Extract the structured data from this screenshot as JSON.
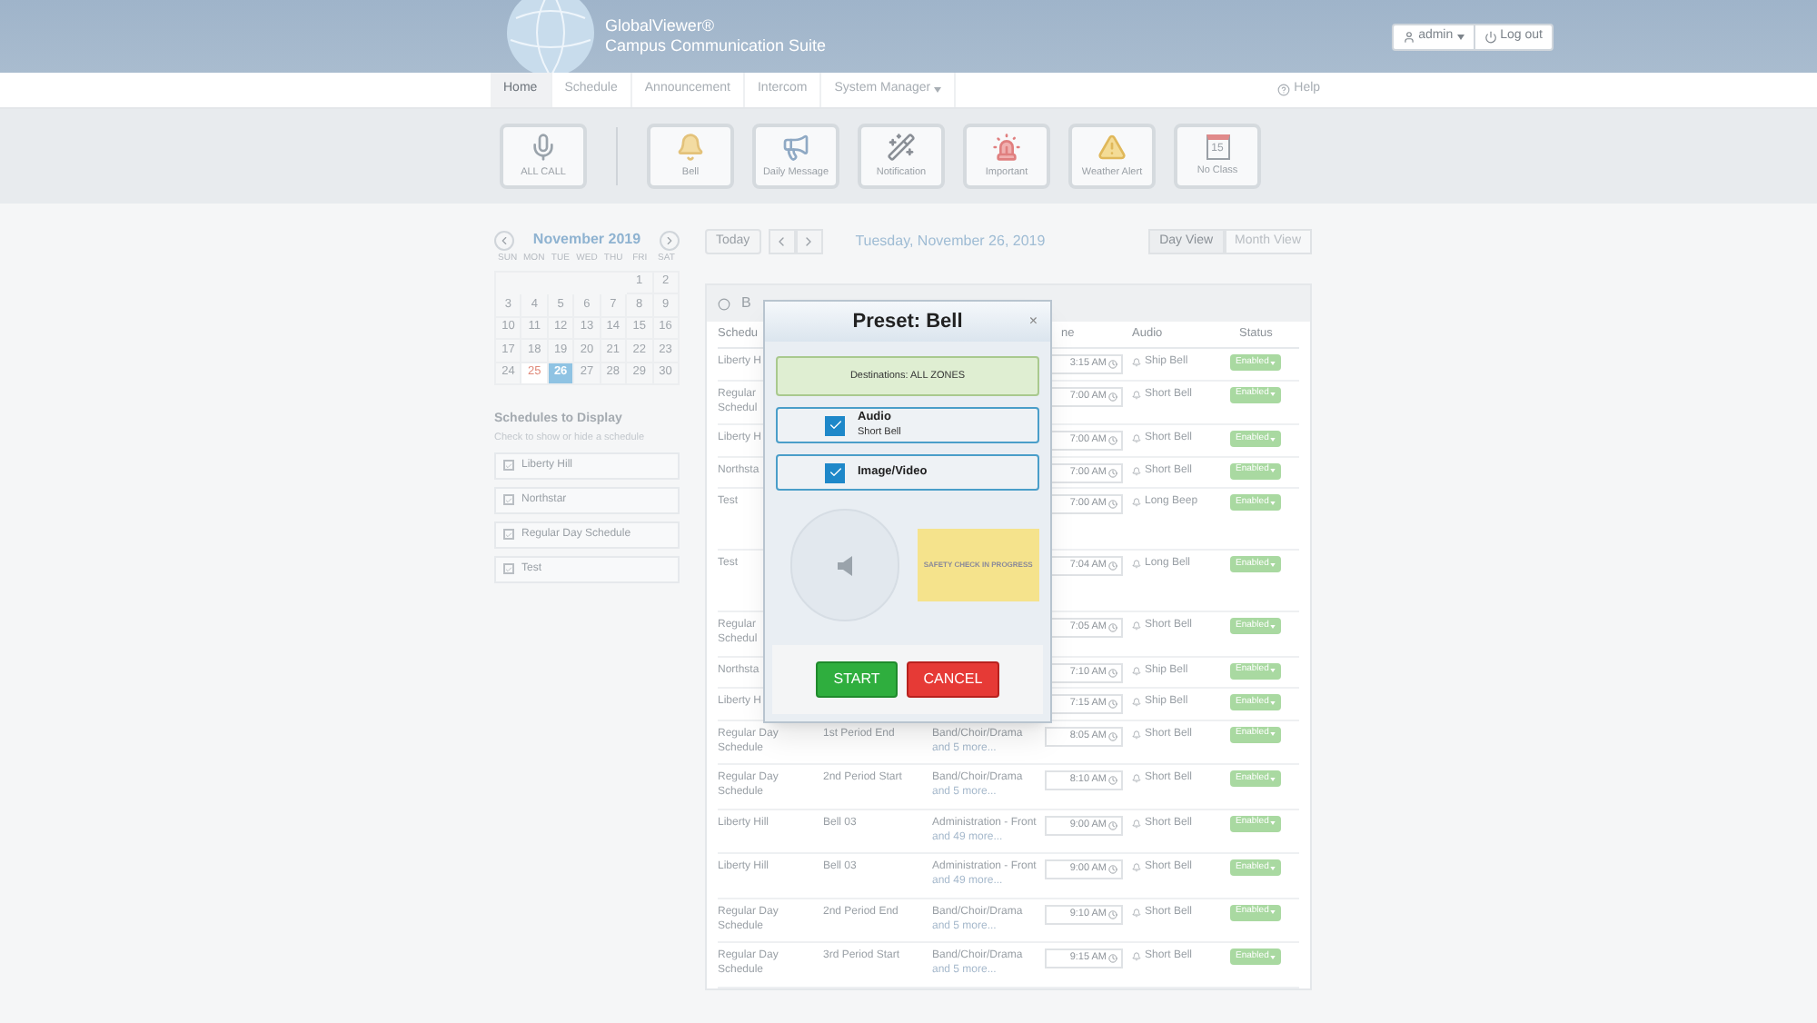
{
  "header": {
    "brand": "GlobalViewer®",
    "subtitle": "Campus Communication Suite",
    "user": "admin",
    "logout": "Log out"
  },
  "nav": {
    "tabs": [
      {
        "label": "Home",
        "selected": true
      },
      {
        "label": "Schedule",
        "selected": false
      },
      {
        "label": "Announcement",
        "selected": false
      },
      {
        "label": "Intercom",
        "selected": false
      },
      {
        "label": "System Manager",
        "selected": false,
        "dropdown": true
      }
    ],
    "help": "Help"
  },
  "presets": [
    {
      "label": "ALL CALL",
      "kind": "mic"
    },
    {
      "label": "Bell",
      "kind": "bell"
    },
    {
      "label": "Daily Message",
      "kind": "megaphone"
    },
    {
      "label": "Notification",
      "kind": "wand"
    },
    {
      "label": "Important",
      "kind": "siren"
    },
    {
      "label": "Weather Alert",
      "kind": "warning"
    },
    {
      "label": "No Class",
      "kind": "calendar",
      "icon_text": "15"
    }
  ],
  "calendar": {
    "month": "November 2019",
    "weekdays": [
      "SUN",
      "MON",
      "TUE",
      "WED",
      "THU",
      "FRI",
      "SAT"
    ],
    "days": [
      {
        "d": "1",
        "today": false,
        "selected": false
      },
      {
        "d": "2",
        "today": false,
        "selected": false
      },
      {
        "d": "3",
        "today": false,
        "selected": false
      },
      {
        "d": "4",
        "today": false,
        "selected": false
      },
      {
        "d": "5",
        "today": false,
        "selected": false
      },
      {
        "d": "6",
        "today": false,
        "selected": false
      },
      {
        "d": "7",
        "today": false,
        "selected": false
      },
      {
        "d": "8",
        "today": false,
        "selected": false
      },
      {
        "d": "9",
        "today": false,
        "selected": false
      },
      {
        "d": "10",
        "today": false,
        "selected": false
      },
      {
        "d": "11",
        "today": false,
        "selected": false
      },
      {
        "d": "12",
        "today": false,
        "selected": false
      },
      {
        "d": "13",
        "today": false,
        "selected": false
      },
      {
        "d": "14",
        "today": false,
        "selected": false
      },
      {
        "d": "15",
        "today": false,
        "selected": false
      },
      {
        "d": "16",
        "today": false,
        "selected": false
      },
      {
        "d": "17",
        "today": false,
        "selected": false
      },
      {
        "d": "18",
        "today": false,
        "selected": false
      },
      {
        "d": "19",
        "today": false,
        "selected": false
      },
      {
        "d": "20",
        "today": false,
        "selected": false
      },
      {
        "d": "21",
        "today": false,
        "selected": false
      },
      {
        "d": "22",
        "today": false,
        "selected": false
      },
      {
        "d": "23",
        "today": false,
        "selected": false
      },
      {
        "d": "24",
        "today": false,
        "selected": false
      },
      {
        "d": "25",
        "today": true,
        "selected": false
      },
      {
        "d": "26",
        "today": false,
        "selected": true
      },
      {
        "d": "27",
        "today": false,
        "selected": false
      },
      {
        "d": "28",
        "today": false,
        "selected": false
      },
      {
        "d": "29",
        "today": false,
        "selected": false
      },
      {
        "d": "30",
        "today": false,
        "selected": false
      }
    ]
  },
  "schedules": {
    "title": "Schedules to Display",
    "hint": "Check to show or hide a schedule",
    "items": [
      {
        "label": "Liberty Hill",
        "checked": true
      },
      {
        "label": "Northstar",
        "checked": true
      },
      {
        "label": "Regular Day Schedule",
        "checked": true
      },
      {
        "label": "Test",
        "checked": true
      }
    ]
  },
  "toolbar": {
    "today": "Today",
    "date": "Tuesday, November 26, 2019",
    "views": [
      {
        "label": "Day View",
        "selected": true
      },
      {
        "label": "Month View",
        "selected": false
      }
    ]
  },
  "panel": {
    "heading": "B"
  },
  "table": {
    "columns": [
      "Schedu",
      "ne",
      "Audio",
      "Status"
    ],
    "rows": [
      {
        "schedule": "Liberty H",
        "time": "3:15 AM",
        "audio": "Ship Bell",
        "status": "Enabled"
      },
      {
        "schedule": "Regular Schedul",
        "time": "7:00 AM",
        "audio": "Short Bell",
        "status": "Enabled",
        "kind": "double"
      },
      {
        "schedule": "Liberty H",
        "time": "7:00 AM",
        "audio": "Short Bell",
        "status": "Enabled"
      },
      {
        "schedule": "Northsta",
        "time": "7:00 AM",
        "audio": "Short Bell",
        "status": "Enabled"
      },
      {
        "schedule": "Test",
        "time": "7:00 AM",
        "audio": "Long Beep",
        "status": "Enabled",
        "kind": "tall"
      },
      {
        "schedule": "Test",
        "time": "7:04 AM",
        "audio": "Long Bell",
        "status": "Enabled",
        "kind": "tall"
      },
      {
        "schedule": "Regular Schedul",
        "time": "7:05 AM",
        "audio": "Short Bell",
        "status": "Enabled",
        "kind": "double"
      },
      {
        "schedule": "Northsta",
        "time": "7:10 AM",
        "audio": "Ship Bell",
        "status": "Enabled"
      },
      {
        "schedule": "Liberty H",
        "time": "7:15 AM",
        "audio": "Ship Bell",
        "status": "Enabled"
      },
      {
        "schedule": "Regular Day Schedule",
        "name": "1st Period End",
        "zones": "Band/Choir/Drama",
        "more": "and 5 more...",
        "time": "8:05 AM",
        "audio": "Short Bell",
        "status": "Enabled"
      },
      {
        "schedule": "Regular Day Schedule",
        "name": "2nd Period Start",
        "zones": "Band/Choir/Drama",
        "more": "and 5 more...",
        "time": "8:10 AM",
        "audio": "Short Bell",
        "status": "Enabled"
      },
      {
        "schedule": "Liberty Hill",
        "name": "Bell 03",
        "zones": "Administration - Front",
        "more": "and 49 more...",
        "time": "9:00 AM",
        "audio": "Short Bell",
        "status": "Enabled"
      },
      {
        "schedule": "Liberty Hill",
        "name": "Bell 03",
        "zones": "Administration - Front",
        "more": "and 49 more...",
        "time": "9:00 AM",
        "audio": "Short Bell",
        "status": "Enabled"
      },
      {
        "schedule": "Regular Day Schedule",
        "name": "2nd Period End",
        "zones": "Band/Choir/Drama",
        "more": "and 5 more...",
        "time": "9:10 AM",
        "audio": "Short Bell",
        "status": "Enabled"
      },
      {
        "schedule": "Regular Day Schedule",
        "name": "3rd Period Start",
        "zones": "Band/Choir/Drama",
        "more": "and 5 more...",
        "time": "9:15 AM",
        "audio": "Short Bell",
        "status": "Enabled"
      }
    ]
  },
  "modal": {
    "title": "Preset: Bell",
    "close": "×",
    "destinations": "Destinations: ALL ZONES",
    "options": [
      {
        "label": "Audio",
        "detail": "Short Bell",
        "checked": true
      },
      {
        "label": "Image/Video",
        "checked": true
      }
    ],
    "banner": "SAFETY CHECK IN PROGRESS",
    "start": "START",
    "cancel": "CANCEL"
  }
}
